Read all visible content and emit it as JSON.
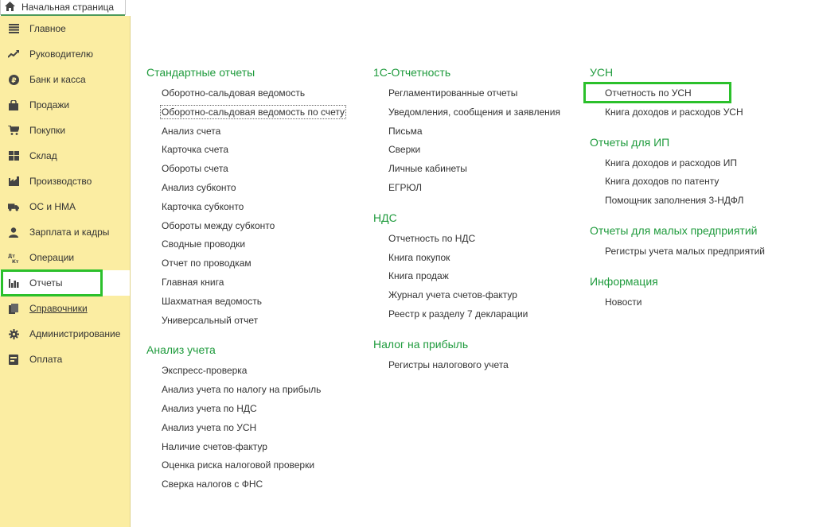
{
  "home_tab": {
    "label": "Начальная страница",
    "icon": "home-icon"
  },
  "sidebar": {
    "items": [
      {
        "label": "Главное",
        "icon": "menu-lines-icon"
      },
      {
        "label": "Руководителю",
        "icon": "trend-up-icon"
      },
      {
        "label": "Банк и касса",
        "icon": "ruble-coin-icon"
      },
      {
        "label": "Продажи",
        "icon": "shopping-bag-icon"
      },
      {
        "label": "Покупки",
        "icon": "cart-icon"
      },
      {
        "label": "Склад",
        "icon": "warehouse-icon"
      },
      {
        "label": "Производство",
        "icon": "factory-icon"
      },
      {
        "label": "ОС и НМА",
        "icon": "truck-icon"
      },
      {
        "label": "Зарплата и кадры",
        "icon": "person-icon"
      },
      {
        "label": "Операции",
        "icon": "dt-kt-icon"
      },
      {
        "label": "Отчеты",
        "icon": "bar-chart-icon"
      },
      {
        "label": "Справочники",
        "icon": "books-icon"
      },
      {
        "label": "Администрирование",
        "icon": "gear-icon"
      },
      {
        "label": "Оплата",
        "icon": "payment-icon"
      }
    ]
  },
  "columns": [
    {
      "sections": [
        {
          "title": "Стандартные отчеты",
          "items": [
            "Оборотно-сальдовая ведомость",
            "Оборотно-сальдовая ведомость по счету",
            "Анализ счета",
            "Карточка счета",
            "Обороты счета",
            "Анализ субконто",
            "Карточка субконто",
            "Обороты между субконто",
            "Сводные проводки",
            "Отчет по проводкам",
            "Главная книга",
            "Шахматная ведомость",
            "Универсальный отчет"
          ]
        },
        {
          "title": "Анализ учета",
          "items": [
            "Экспресс-проверка",
            "Анализ учета по налогу на прибыль",
            "Анализ учета по НДС",
            "Анализ учета по УСН",
            "Наличие счетов-фактур",
            "Оценка риска налоговой проверки",
            "Сверка налогов с ФНС"
          ]
        }
      ]
    },
    {
      "sections": [
        {
          "title": "1С-Отчетность",
          "items": [
            "Регламентированные отчеты",
            "Уведомления, сообщения и заявления",
            "Письма",
            "Сверки",
            "Личные кабинеты",
            "ЕГРЮЛ"
          ]
        },
        {
          "title": "НДС",
          "items": [
            "Отчетность по НДС",
            "Книга покупок",
            "Книга продаж",
            "Журнал учета счетов-фактур",
            "Реестр к разделу 7 декларации"
          ]
        },
        {
          "title": "Налог на прибыль",
          "items": [
            "Регистры налогового учета"
          ]
        }
      ]
    },
    {
      "sections": [
        {
          "title": "УСН",
          "items": [
            "Отчетность по УСН",
            "Книга доходов и расходов УСН"
          ]
        },
        {
          "title": "Отчеты для ИП",
          "items": [
            "Книга доходов и расходов ИП",
            "Книга доходов по патенту",
            "Помощник заполнения 3-НДФЛ"
          ]
        },
        {
          "title": "Отчеты для малых предприятий",
          "items": [
            "Регистры учета малых предприятий"
          ]
        },
        {
          "title": "Информация",
          "items": [
            "Новости"
          ]
        }
      ]
    }
  ],
  "colors": {
    "accent_green": "#1f9b3d",
    "highlight_frame": "#2bc02b",
    "sidebar_bg": "#fbeda2"
  }
}
